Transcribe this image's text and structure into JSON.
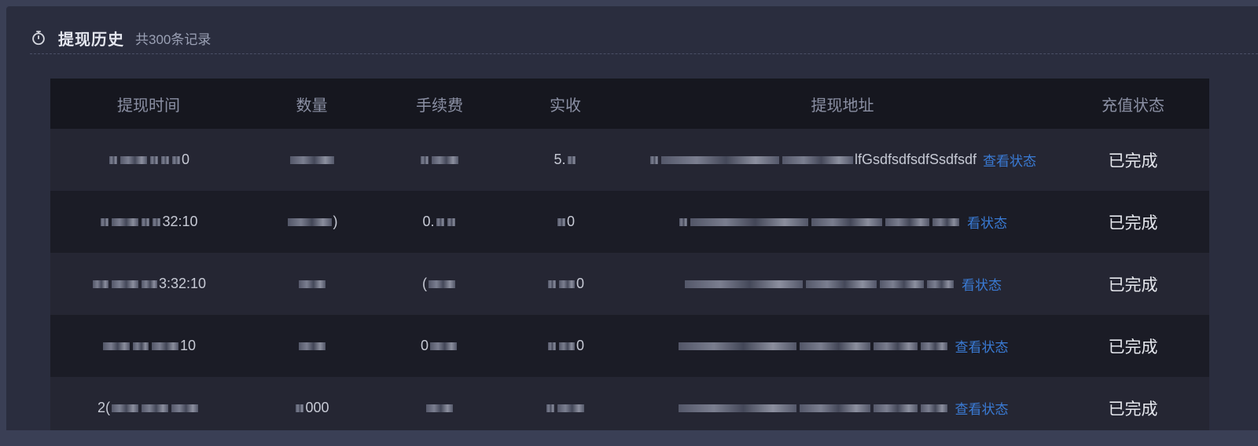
{
  "header": {
    "title": "提现历史",
    "subtitle": "共300条记录"
  },
  "table": {
    "columns": [
      "提现时间",
      "数量",
      "手续费",
      "实收",
      "提现地址",
      "充值状态"
    ],
    "rows": [
      {
        "time_tail": "0",
        "qty_tail": "",
        "fee_prefix": "",
        "fee_tail": "",
        "received_prefix": "5.",
        "received_tail": "",
        "address_tail": "lfGsdfsdfsdfSsdfsdf",
        "link": "查看状态",
        "status": "已完成"
      },
      {
        "time_tail": "32:10",
        "qty_tail": ")",
        "fee_prefix": "0.",
        "fee_tail": "",
        "received_prefix": "",
        "received_tail": "0",
        "address_tail": "",
        "link": "看状态",
        "status": "已完成"
      },
      {
        "time_tail": "3:32:10",
        "qty_tail": "",
        "fee_prefix": "(",
        "fee_tail": "",
        "received_prefix": "",
        "received_tail": "0",
        "address_tail": "",
        "link": "看状态",
        "status": "已完成"
      },
      {
        "time_tail": "10",
        "qty_tail": "",
        "fee_prefix": "0",
        "fee_tail": "",
        "received_prefix": "",
        "received_tail": "0",
        "address_tail": "",
        "link": "查看状态",
        "status": "已完成"
      },
      {
        "time_tail": "2(",
        "qty_tail": "000",
        "fee_prefix": "",
        "fee_tail": "",
        "received_prefix": "",
        "received_tail": "",
        "address_tail": "",
        "link": "查看状态",
        "status": "已完成"
      }
    ]
  },
  "colors": {
    "background": "#3a3f55",
    "panel": "#2a2d3e",
    "header_row": "#16171f",
    "row_even": "#252633",
    "row_odd": "#1b1c26",
    "link": "#3a7bd5"
  },
  "icons": {
    "title_icon": "stopwatch-icon"
  }
}
